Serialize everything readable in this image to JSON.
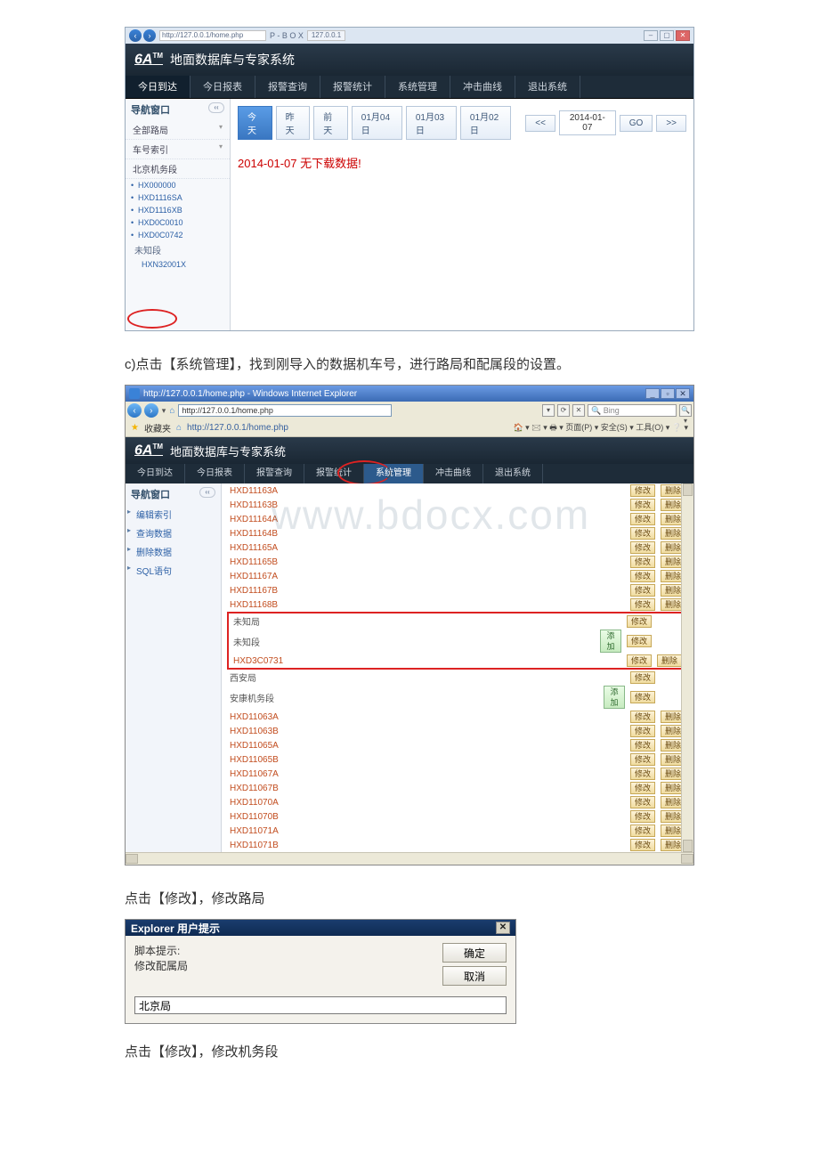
{
  "ss1": {
    "addr_display": "http://127.0.0.1/home.php",
    "addr_short": "P - B O X",
    "tab_label": "127.0.0.1",
    "app_title": "地面数据库与专家系统",
    "logo": "6A",
    "logo_sup": "TM",
    "nav": [
      "今日到达",
      "今日报表",
      "报警查询",
      "报警统计",
      "系统管理",
      "冲击曲线",
      "退出系统"
    ],
    "nav_active": 0,
    "side_title": "导航窗口",
    "side_rows": [
      "全部路局",
      "车号索引",
      "北京机务段"
    ],
    "tree": [
      "HX000000",
      "HXD1116SA",
      "HXD1116XB",
      "HXD0C0010",
      "HXD0C0742"
    ],
    "unk": "未知段",
    "last": "HXN32001X",
    "datebar": {
      "today": "今天",
      "yest": "昨天",
      "dayb": "前天",
      "d1": "01月04日",
      "d2": "01月03日",
      "d3": "01月02日",
      "prev": "<<",
      "date": "2014-01-07",
      "go": "GO",
      "next": ">>"
    },
    "no_data": "2014-01-07 无下载数据!"
  },
  "caption1": "c)点击【系统管理】，找到刚导入的数据机车号，进行路局和配属段的设置。",
  "ss2": {
    "win_title": "http://127.0.0.1/home.php - Windows Internet Explorer",
    "addr": "http://127.0.0.1/home.php",
    "search_placeholder": "Bing",
    "fav_label": "收藏夹",
    "fav_url": "http://127.0.0.1/home.php",
    "right_menu": "🏠 ▾ 🖂 ▾ 🖶 ▾ 页面(P) ▾ 安全(S) ▾ 工具(O) ▾ ❔ ▾",
    "app_title": "地面数据库与专家系统",
    "nav": [
      "今日到达",
      "今日报表",
      "报警查询",
      "报警统计",
      "系统管理",
      "冲击曲线",
      "退出系统"
    ],
    "nav_active": 4,
    "side_title": "导航窗口",
    "side_rows": [
      "编辑索引",
      "查询数据",
      "删除数据",
      "SQL语句"
    ],
    "btn_mod": "修改",
    "btn_del": "删除",
    "btn_add": "添加",
    "rows_top": [
      "HXD11163A",
      "HXD11163B",
      "HXD11164A",
      "HXD11164B",
      "HXD11165A",
      "HXD11165B",
      "HXD11167A",
      "HXD11167B",
      "HXD11168B"
    ],
    "group_unk1": "未知局",
    "group_unk2": "未知段",
    "row_unk": "HXD3C0731",
    "group_xa": "西安局",
    "group_xa_sub": "安康机务段",
    "rows_xa": [
      "HXD11063A",
      "HXD11063B",
      "HXD11065A",
      "HXD11065B",
      "HXD11067A",
      "HXD11067B",
      "HXD11070A",
      "HXD11070B",
      "HXD11071A",
      "HXD11071B"
    ],
    "watermark": "www.bdocx.com"
  },
  "caption2": "点击【修改】，修改路局",
  "dlg": {
    "title": "Explorer 用户提示",
    "line1": "脚本提示:",
    "line2": "修改配属局",
    "ok": "确定",
    "cancel": "取消",
    "value": "北京局"
  },
  "caption3": "点击【修改】，修改机务段"
}
